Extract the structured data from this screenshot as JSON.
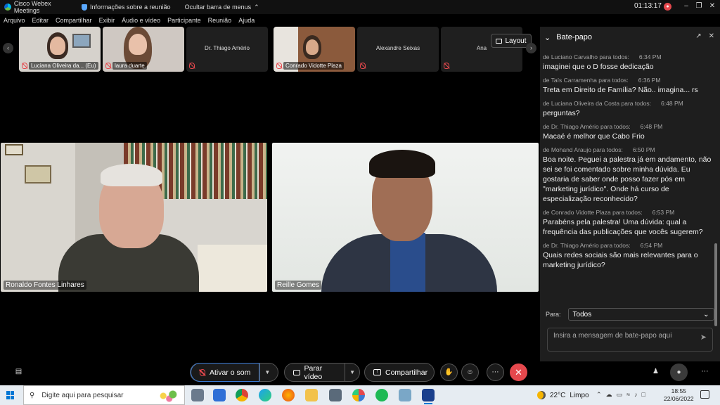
{
  "titlebar": {
    "app_name": "Cisco Webex Meetings",
    "meeting_info": "Informações sobre a reunião",
    "hide_menu": "Ocultar barra de menus",
    "clock": "01:13:17"
  },
  "menu": [
    "Arquivo",
    "Editar",
    "Compartilhar",
    "Exibir",
    "Áudio e vídeo",
    "Participante",
    "Reunião",
    "Ajuda"
  ],
  "thumbnails": [
    {
      "name": "Luciana Oliveira da... (Eu)",
      "has_video": true
    },
    {
      "name": "laura duarte",
      "has_video": true
    },
    {
      "name": "Dr. Thiago Amério",
      "has_video": false
    },
    {
      "name": "Conrado Vidotte Plaza",
      "has_video": true
    },
    {
      "name": "Alexandre Seixas",
      "has_video": false
    },
    {
      "name": "Ana",
      "has_video": false
    }
  ],
  "layout_label": "Layout",
  "videos": {
    "left_name": "Ronaldo Fontes Linhares",
    "right_name": "Reille Gomes"
  },
  "chat": {
    "title": "Bate-papo",
    "messages": [
      {
        "meta": "de Luciano Carvalho para todos:",
        "time": "6:34 PM",
        "text": "imaginei que o D fosse dedicação"
      },
      {
        "meta": "de Taís Carramenha para todos:",
        "time": "6:36 PM",
        "text": "Treta em Direito de Família? Não.. imagina... rs"
      },
      {
        "meta": "de Luciana Oliveira da Costa para todos:",
        "time": "6:48 PM",
        "text": "perguntas?"
      },
      {
        "meta": "de Dr. Thiago Amério para todos:",
        "time": "6:48 PM",
        "text": "Macaé é melhor que Cabo Frio"
      },
      {
        "meta": "de Mohand Araujo para todos:",
        "time": "6:50 PM",
        "text": "Boa noite. Peguei a palestra já em andamento, não sei se foi comentado sobre minha dúvida. Eu gostaria de saber onde posso fazer pós em \"marketing jurídico\". Onde há curso de especialização reconhecido?"
      },
      {
        "meta": "de Conrado Vidotte Plaza para todos:",
        "time": "6:53 PM",
        "text": "Parabéns pela palestra! Uma dúvida: qual a frequência das publicações que vocês sugerem?"
      },
      {
        "meta": "de Dr. Thiago Amério para todos:",
        "time": "6:54 PM",
        "text": "Quais redes sociais são mais relevantes para o marketing jurídico?"
      }
    ],
    "to_label": "Para:",
    "to_value": "Todos",
    "input_placeholder": "Insira a mensagem de bate-papo aqui"
  },
  "controls": {
    "unmute": "Ativar o som",
    "stop_video": "Parar vídeo",
    "share": "Compartilhar"
  },
  "taskbar": {
    "search_placeholder": "Digite aqui para pesquisar",
    "weather_temp": "22°C",
    "weather_text": "Limpo",
    "time": "18:55",
    "date": "22/06/2022"
  },
  "colors": {
    "accent_blue": "#3a7bd5",
    "end_red": "#e5484d",
    "panel_bg": "#1e1e1e"
  }
}
